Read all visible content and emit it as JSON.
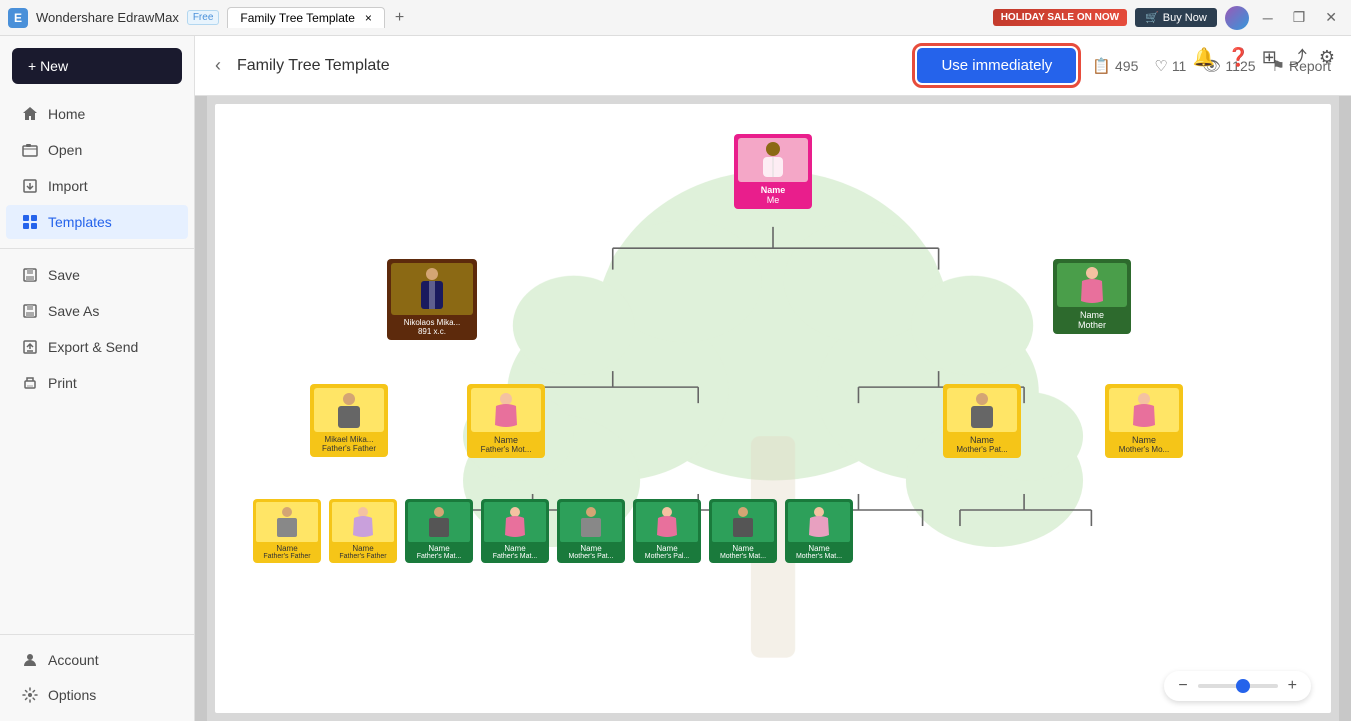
{
  "titlebar": {
    "app_name": "Wondershare EdrawMax",
    "free_badge": "Free",
    "tab_label": "×",
    "holiday_label": "HOLIDAY SALE ON NOW",
    "buy_label": "Buy Now"
  },
  "header": {
    "back_icon": "‹",
    "title": "Family Tree Template",
    "use_btn": "Use immediately",
    "copies": "495",
    "likes": "11",
    "views": "1125",
    "report": "Report"
  },
  "sidebar": {
    "new_btn": "+ New",
    "items": [
      {
        "label": "Home",
        "icon": "🏠",
        "active": false
      },
      {
        "label": "Open",
        "icon": "📄",
        "active": false
      },
      {
        "label": "Import",
        "icon": "⬆",
        "active": false
      },
      {
        "label": "Templates",
        "icon": "⊞",
        "active": true
      },
      {
        "label": "Save",
        "icon": "💾",
        "active": false
      },
      {
        "label": "Save As",
        "icon": "💾",
        "active": false
      },
      {
        "label": "Export & Send",
        "icon": "📤",
        "active": false
      },
      {
        "label": "Print",
        "icon": "🖨",
        "active": false
      }
    ],
    "bottom_items": [
      {
        "label": "Account",
        "icon": "⚙"
      },
      {
        "label": "Options",
        "icon": "⚙"
      }
    ]
  },
  "tree": {
    "me": {
      "label": "Name",
      "sublabel": "Me"
    },
    "father": {
      "label": "Nikolaos Mika...",
      "sublabel": "891 x.c."
    },
    "mother": {
      "label": "Name",
      "sublabel": "Mother"
    },
    "ff": {
      "label": "Mikael Mika...",
      "sublabel": "Father's Father"
    },
    "fm": {
      "label": "Name",
      "sublabel": "Father's Mot..."
    },
    "mf": {
      "label": "Name",
      "sublabel": "Mother's Pat..."
    },
    "mm": {
      "label": "Name",
      "sublabel": "Mother's Mo..."
    },
    "row4": [
      {
        "label": "Name",
        "sublabel": "Father's Father",
        "gender": "male"
      },
      {
        "label": "Name",
        "sublabel": "Father's Father",
        "gender": "female"
      },
      {
        "label": "Name",
        "sublabel": "Father's Mat...",
        "gender": "male"
      },
      {
        "label": "Name",
        "sublabel": "Father's Mat...",
        "gender": "female"
      },
      {
        "label": "Name",
        "sublabel": "Mother's Pat...",
        "gender": "male"
      },
      {
        "label": "Name",
        "sublabel": "Mother's Pal...",
        "gender": "female"
      },
      {
        "label": "Name",
        "sublabel": "Mother's Mat...",
        "gender": "male"
      },
      {
        "label": "Name",
        "sublabel": "Mother's Mat...",
        "gender": "female"
      }
    ]
  },
  "zoom": {
    "minus": "−",
    "plus": "+"
  }
}
